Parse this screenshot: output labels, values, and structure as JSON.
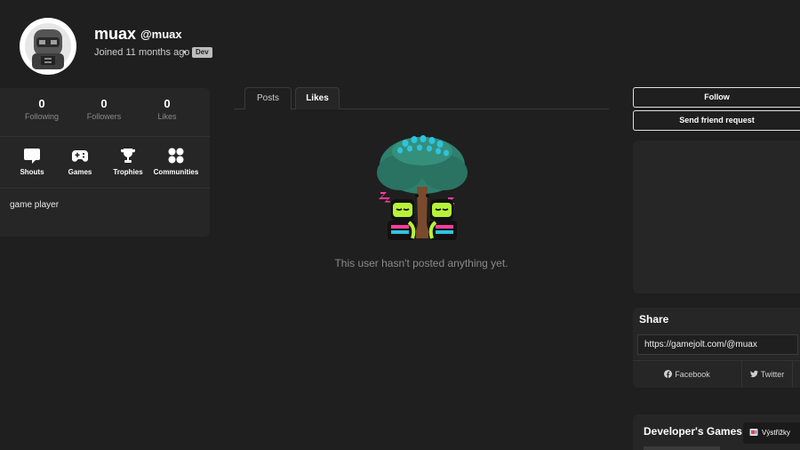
{
  "profile": {
    "display_name": "muax",
    "username": "@muax",
    "joined": "Joined 11 months ago",
    "separator": "•",
    "badge": "Dev",
    "bio": "game player"
  },
  "stats": [
    {
      "value": "0",
      "label": "Following"
    },
    {
      "value": "0",
      "label": "Followers"
    },
    {
      "value": "0",
      "label": "Likes"
    }
  ],
  "nav": [
    {
      "label": "Shouts",
      "icon": "shouts-icon"
    },
    {
      "label": "Games",
      "icon": "gamepad-icon"
    },
    {
      "label": "Trophies",
      "icon": "trophy-icon"
    },
    {
      "label": "Communities",
      "icon": "communities-icon"
    }
  ],
  "tabs": [
    {
      "label": "Posts"
    },
    {
      "label": "Likes"
    }
  ],
  "feed": {
    "empty_text": "This user hasn't posted anything yet."
  },
  "actions": {
    "follow": "Follow",
    "friend_request": "Send friend request"
  },
  "share": {
    "title": "Share",
    "url": "https://gamejolt.com/@muax",
    "facebook": "Facebook",
    "twitter": "Twitter"
  },
  "developer_games": {
    "title": "Developer's Games"
  },
  "clip": {
    "label": "Výstřižky"
  },
  "colors": {
    "background": "#1f1f1f",
    "card": "#262626",
    "badge": "#bdbdbd",
    "muted": "#8a8a8a"
  }
}
